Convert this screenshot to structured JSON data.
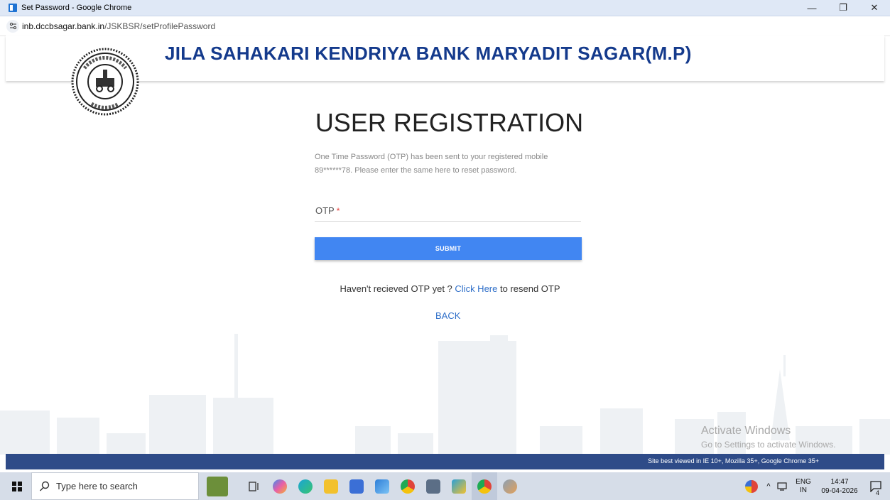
{
  "window": {
    "title": "Set Password - Google Chrome",
    "minimize_glyph": "—",
    "maximize_glyph": "❐",
    "close_glyph": "✕"
  },
  "browser": {
    "url_host": "inb.dccbsagar.bank.in",
    "url_path": "/JSKBSR/setProfilePassword"
  },
  "header": {
    "bank_name": "JILA SAHAKARI KENDRIYA BANK MARYADIT SAGAR(M.P)",
    "seal_icon": "bank-seal-logo"
  },
  "form": {
    "heading": "USER REGISTRATION",
    "otp_message": "One Time Password (OTP) has been sent to your registered mobile 89******78. Please enter the same here to reset password.",
    "otp_label": "OTP",
    "required_marker": "*",
    "otp_value": "",
    "submit_label": "SUBMIT",
    "resend_prefix": "Haven't recieved OTP yet ? ",
    "resend_link": "Click Here",
    "resend_suffix": " to resend OTP",
    "back_label": "BACK"
  },
  "watermark": {
    "line1": "Activate Windows",
    "line2": "Go to Settings to activate Windows."
  },
  "footer": {
    "text": "Site best viewed in IE 10+, Mozilla 35+, Google Chrome 35+"
  },
  "taskbar": {
    "search_placeholder": "Type here to search",
    "lang_line1": "ENG",
    "lang_line2": "IN",
    "time": "14:47",
    "date": "09-04-2026",
    "notification_count": "4",
    "apps": [
      "task-view-icon",
      "copilot-icon",
      "edge-icon",
      "file-explorer-icon",
      "store-icon",
      "photos-icon",
      "chrome-icon",
      "app-icon",
      "lock-app-icon",
      "chrome-active-icon",
      "paint-icon"
    ]
  },
  "colors": {
    "brand_blue": "#143a8c",
    "button_blue": "#4186f2",
    "footer_blue": "#2e4b88",
    "link_blue": "#2f6fc9"
  }
}
